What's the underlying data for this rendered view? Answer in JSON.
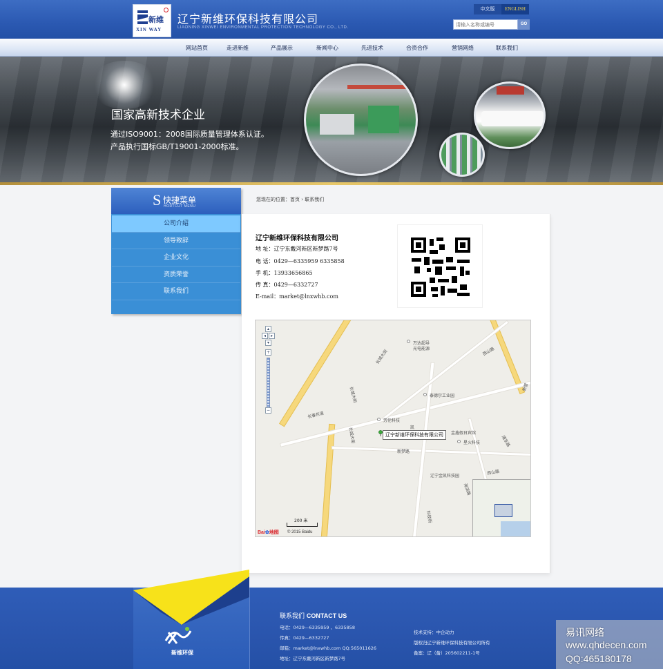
{
  "header": {
    "logo_cn": "新维",
    "logo_en": "XIN WAY",
    "company_cn": "辽宁新维环保科技有限公司",
    "company_en": "LIAONING XINWEI  ENVIRONMENTAL PROTECTION TECHNOLOGY CO., LTD.",
    "lang_cn": "中文版",
    "lang_en": "ENGLISH",
    "search_placeholder": "请输入名称或编号",
    "search_button": "GO"
  },
  "nav": {
    "items": [
      "网站首页",
      "走进新维",
      "产品展示",
      "新闻中心",
      "先进技术",
      "合资合作",
      "营销网络",
      "联系我们"
    ]
  },
  "banner": {
    "title": "国家高新技术企业",
    "line1": "通过ISO9001：2008国际质量管理体系认证。",
    "line2": "产品执行国标GB/T19001-2000标准。"
  },
  "sidebar": {
    "letter": "S",
    "title": "快捷菜单",
    "subtitle": "HORTCUT MENU",
    "items": [
      "公司介绍",
      "领导致辞",
      "企业文化",
      "资质荣誉",
      "联系我们"
    ],
    "active_index": 0
  },
  "breadcrumb": "您现在的位置：首页 › 联系我们",
  "contact": {
    "company": "辽宁新维环保科技有限公司",
    "address": "地  址：辽宁东戴河新区新梦路7号",
    "phone": "电  话：0429—6335959 6335858",
    "mobile": "手  机：13933656865",
    "fax": "传  真：0429—6332727",
    "email": "E-mail：market@lnxwhb.com"
  },
  "map": {
    "labels": {
      "changcheng1": "长城大街",
      "changcheng2": "长城大街",
      "changcheng3": "长城大街",
      "changchun": "长春东道",
      "wanda": "万达超导",
      "wanda2": "光电能源",
      "xishan": "西山路",
      "taide": "泰德尔工业园",
      "fanglun": "芳伦科技",
      "jinxin": "金鑫假日宾馆",
      "xinghuo": "星火科技",
      "xinmeng": "新梦路",
      "jinkai": "辽宁金凯科技园",
      "keji": "科技街",
      "jiangyu": "凯",
      "xinqing": "新营",
      "jingfeng": "浦东路",
      "xishan2": "西山路",
      "yushou": "海滨路"
    },
    "pin_label": "辽宁新维环保科技有限公司",
    "scale": "200 米",
    "baidu": "Bai",
    "baidu2": "地图",
    "copyright": "© 2015 Baidu"
  },
  "footer": {
    "brand": "新维环保",
    "contact_title_cn": "联系我们",
    "contact_title_en": "CONTACT  US",
    "phone": "电话：0429—6335959 、6335858",
    "fax": "传真：0429—6332727",
    "email": "邮箱：market@lnxwhb.com  QQ:565011626",
    "address": "地址：辽宁东戴河新区新梦路7号",
    "support": "技术支持：中企动力",
    "rights": "版权归辽宁新维环保科技有限公司所有",
    "icp": "备案：辽（备）205602211-1号"
  },
  "watermark": {
    "line1": "易讯网络",
    "line2": "www.qhdecen.com",
    "line3": "QQ:465180178"
  }
}
